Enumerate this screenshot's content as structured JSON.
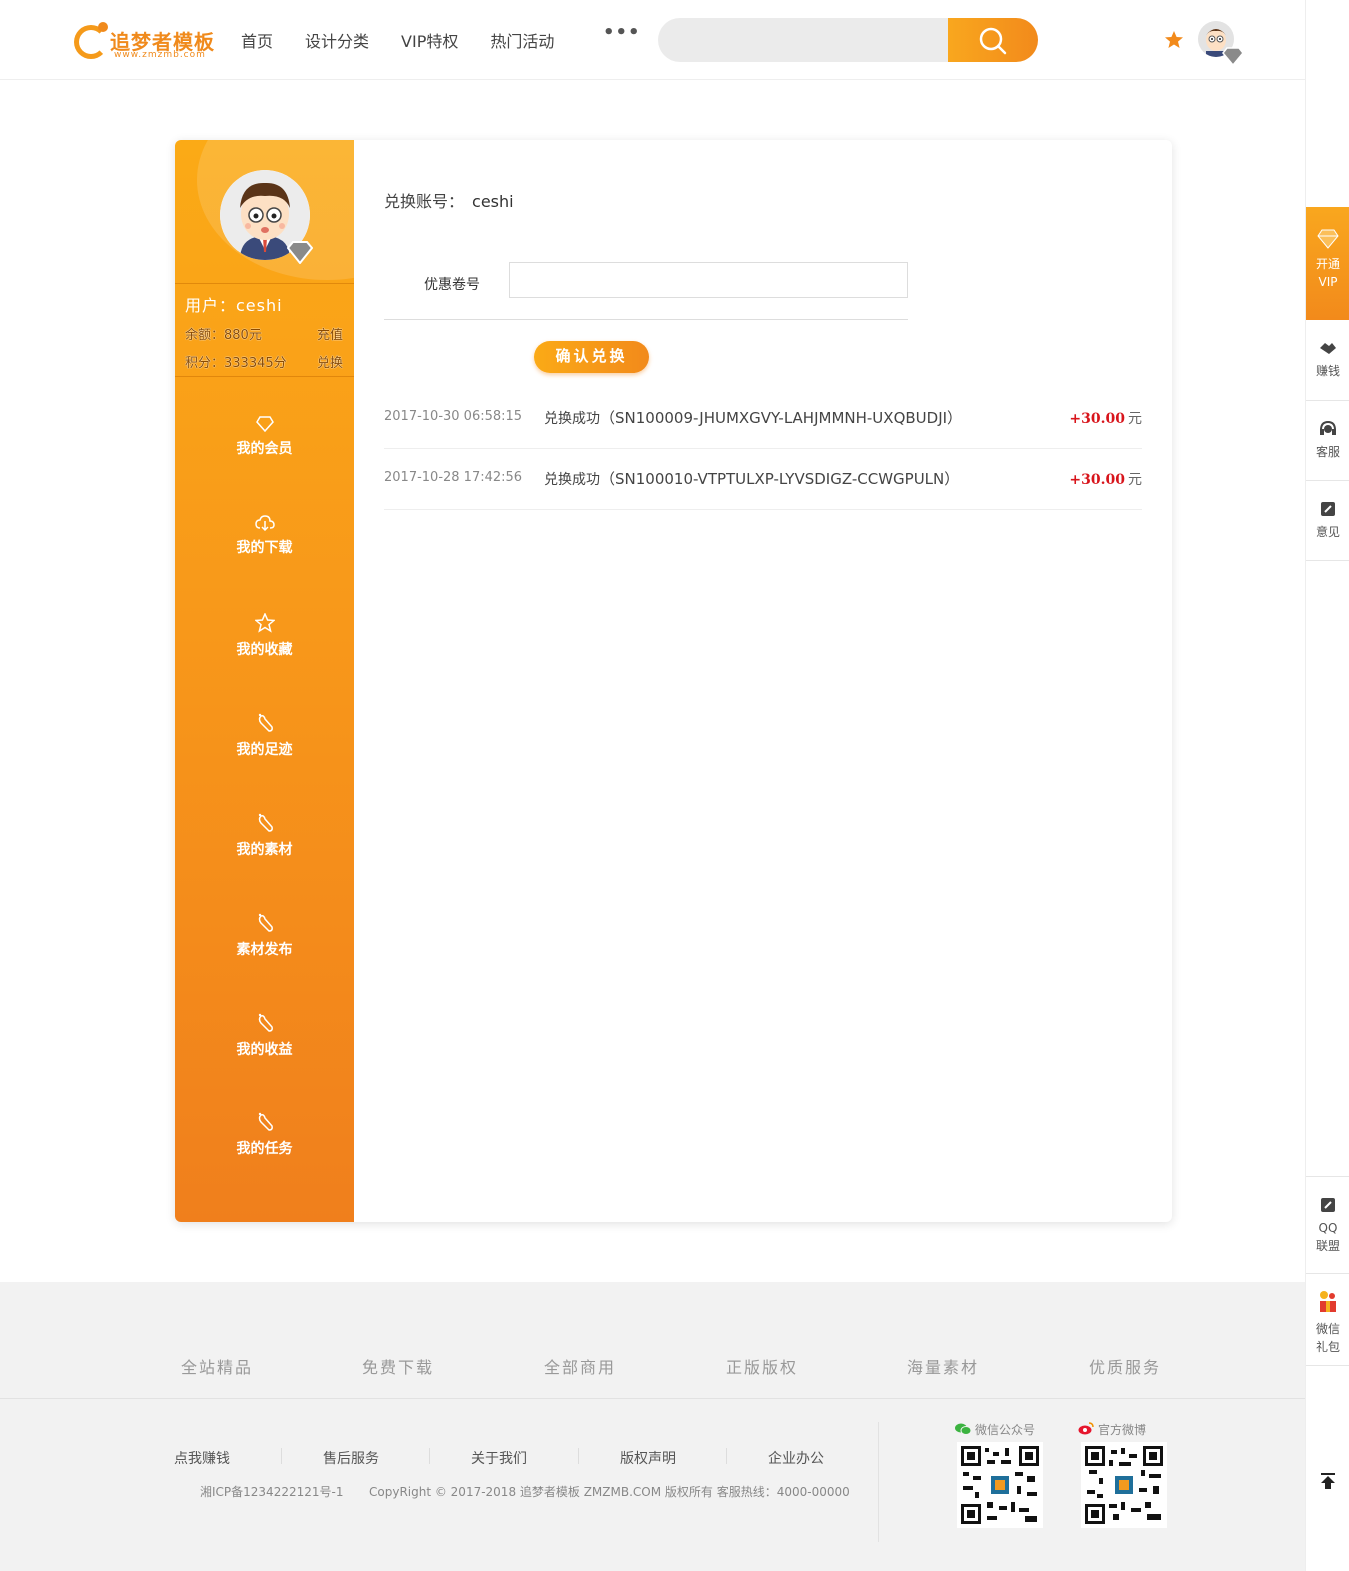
{
  "header": {
    "logo_text": "追梦者模板",
    "logo_sub": "www.zmzmb.com",
    "nav": [
      "首页",
      "设计分类",
      "VIP特权",
      "热门活动"
    ],
    "more": "•••",
    "search_placeholder": ""
  },
  "right_bar": {
    "vip_line1": "开通",
    "vip_line2": "VIP",
    "earn": "赚钱",
    "service": "客服",
    "feedback": "意见",
    "qq_line1": "QQ",
    "qq_line2": "联盟",
    "wx_line1": "微信",
    "wx_line2": "礼包"
  },
  "sidebar": {
    "user": "用户：ceshi",
    "balance_label": "余额：880元",
    "balance_action": "充值",
    "points_label": "积分：333345分",
    "points_action": "兑换",
    "menu": [
      "我的会员",
      "我的下载",
      "我的收藏",
      "我的足迹",
      "我的素材",
      "素材发布",
      "我的收益",
      "我的任务"
    ]
  },
  "main": {
    "account_label": "兑换账号：",
    "account_name": "ceshi",
    "coupon_label": "优惠卷号",
    "coupon_value": "",
    "confirm": "确认兑换",
    "currency": "元",
    "records": [
      {
        "time": "2017-10-30 06:58:15",
        "status": "兑换成功",
        "code": "SN100009-JHUMXGVY-LAHJMMNH-UXQBUDJI",
        "amount": "+30.00"
      },
      {
        "time": "2017-10-28 17:42:56",
        "status": "兑换成功",
        "code": "SN100010-VTPTULXP-LYVSDIGZ-CCWGPULN",
        "amount": "+30.00"
      }
    ]
  },
  "footer": {
    "features": [
      "全站精品",
      "免费下载",
      "全部商用",
      "正版版权",
      "海量素材",
      "优质服务"
    ],
    "links": [
      "点我赚钱",
      "售后服务",
      "关于我们",
      "版权声明",
      "企业办公"
    ],
    "icp": "湘ICP备1234222121号-1",
    "copyright": "CopyRight © 2017-2018 追梦者模板 ZMZMB.COM 版权所有 客服热线：4000-00000",
    "wechat_label": "微信公众号",
    "weibo_label": "官方微博"
  },
  "colors": {
    "brand": "#f59a1a",
    "amount": "#d8141b"
  }
}
